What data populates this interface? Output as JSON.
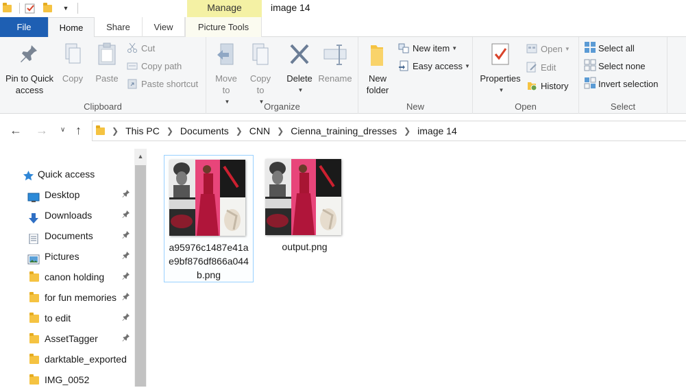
{
  "titlebar": {
    "manage_label": "Manage",
    "window_title": "image 14"
  },
  "tabs": {
    "file": "File",
    "home": "Home",
    "share": "Share",
    "view": "View",
    "picture_tools": "Picture Tools"
  },
  "ribbon": {
    "clipboard": {
      "label": "Clipboard",
      "pin": "Pin to Quick access",
      "copy": "Copy",
      "paste": "Paste",
      "cut": "Cut",
      "copy_path": "Copy path",
      "paste_shortcut": "Paste shortcut"
    },
    "organize": {
      "label": "Organize",
      "move_to": "Move to",
      "copy_to": "Copy to",
      "delete": "Delete",
      "rename": "Rename"
    },
    "new": {
      "label": "New",
      "new_folder": "New folder",
      "new_item": "New item",
      "easy_access": "Easy access"
    },
    "open": {
      "label": "Open",
      "properties": "Properties",
      "open": "Open",
      "edit": "Edit",
      "history": "History"
    },
    "select": {
      "label": "Select",
      "select_all": "Select all",
      "select_none": "Select none",
      "invert_selection": "Invert selection"
    }
  },
  "address": {
    "crumbs": [
      "This PC",
      "Documents",
      "CNN",
      "Cienna_training_dresses",
      "image 14"
    ]
  },
  "navpane": {
    "quick_access": "Quick access",
    "items": [
      {
        "label": "Desktop",
        "icon": "desktop-icon",
        "pinned": true
      },
      {
        "label": "Downloads",
        "icon": "download-icon",
        "pinned": true
      },
      {
        "label": "Documents",
        "icon": "documents-icon",
        "pinned": true
      },
      {
        "label": "Pictures",
        "icon": "pictures-icon",
        "pinned": true
      },
      {
        "label": "canon holding",
        "icon": "folder-icon",
        "pinned": true
      },
      {
        "label": "for fun memories",
        "icon": "folder-icon",
        "pinned": true
      },
      {
        "label": "to edit",
        "icon": "folder-icon",
        "pinned": true
      },
      {
        "label": "AssetTagger",
        "icon": "folder-icon",
        "pinned": true
      },
      {
        "label": "darktable_exported",
        "icon": "folder-icon",
        "pinned": false
      },
      {
        "label": "IMG_0052",
        "icon": "folder-icon",
        "pinned": false
      }
    ]
  },
  "files": [
    {
      "name": "a95976c1487e41ae9bf876df866a044b.png",
      "selected": true
    },
    {
      "name": "output.png",
      "selected": false
    }
  ],
  "colors": {
    "file_tab": "#1e5fb3",
    "manage_tab": "#f4f1a4",
    "selection_border": "#99d1ff",
    "folder": "#f5c342"
  }
}
